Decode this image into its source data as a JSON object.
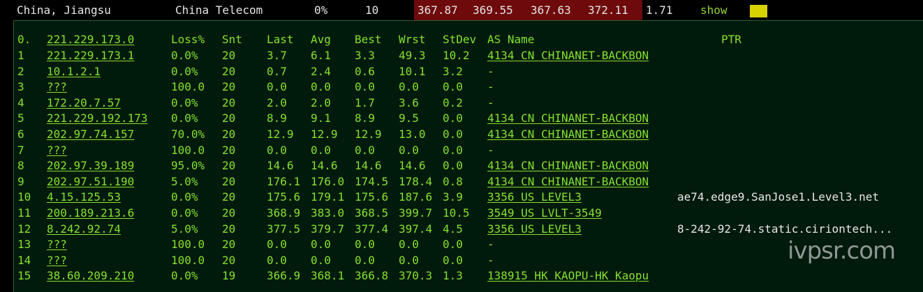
{
  "summary": {
    "location": "China, Jiangsu",
    "isp": "China Telecom",
    "loss": "0%",
    "sent": "10",
    "values": [
      "367.87",
      "369.55",
      "367.63",
      "372.11"
    ],
    "stdev": "1.71",
    "show_label": "show"
  },
  "table": {
    "headers": {
      "hop": "0.",
      "host": "221.229.173.0",
      "loss": "Loss%",
      "snt": "Snt",
      "last": "Last",
      "avg": "Avg",
      "best": "Best",
      "wrst": "Wrst",
      "stdev": "StDev",
      "as": "AS Name",
      "ptr": "PTR"
    },
    "rows": [
      {
        "hop": "1",
        "host": "221.229.173.1",
        "loss": "0.0%",
        "snt": "20",
        "last": "3.7",
        "avg": "6.1",
        "best": "3.3",
        "wrst": "49.3",
        "stdev": "10.2",
        "as": "4134  CN CHINANET-BACKBON",
        "ptr": ""
      },
      {
        "hop": "2",
        "host": "10.1.2.1",
        "loss": "0.0%",
        "snt": "20",
        "last": "0.7",
        "avg": "2.4",
        "best": "0.6",
        "wrst": "10.1",
        "stdev": "3.2",
        "as": "-",
        "ptr": ""
      },
      {
        "hop": "3",
        "host": "???",
        "loss": "100.0",
        "snt": "20",
        "last": "0.0",
        "avg": "0.0",
        "best": "0.0",
        "wrst": "0.0",
        "stdev": "0.0",
        "as": "-",
        "ptr": ""
      },
      {
        "hop": "4",
        "host": "172.20.7.57",
        "loss": "0.0%",
        "snt": "20",
        "last": "2.0",
        "avg": "2.0",
        "best": "1.7",
        "wrst": "3.6",
        "stdev": "0.2",
        "as": "-",
        "ptr": ""
      },
      {
        "hop": "5",
        "host": "221.229.192.173",
        "loss": "0.0%",
        "snt": "20",
        "last": "8.9",
        "avg": "9.1",
        "best": "8.9",
        "wrst": "9.5",
        "stdev": "0.0",
        "as": "4134  CN CHINANET-BACKBON",
        "ptr": ""
      },
      {
        "hop": "6",
        "host": "202.97.74.157",
        "loss": "70.0%",
        "snt": "20",
        "last": "12.9",
        "avg": "12.9",
        "best": "12.9",
        "wrst": "13.0",
        "stdev": "0.0",
        "as": "4134  CN CHINANET-BACKBON",
        "ptr": ""
      },
      {
        "hop": "7",
        "host": "???",
        "loss": "100.0",
        "snt": "20",
        "last": "0.0",
        "avg": "0.0",
        "best": "0.0",
        "wrst": "0.0",
        "stdev": "0.0",
        "as": "-",
        "ptr": ""
      },
      {
        "hop": "8",
        "host": "202.97.39.189",
        "loss": "95.0%",
        "snt": "20",
        "last": "14.6",
        "avg": "14.6",
        "best": "14.6",
        "wrst": "14.6",
        "stdev": "0.0",
        "as": "4134  CN CHINANET-BACKBON",
        "ptr": ""
      },
      {
        "hop": "9",
        "host": "202.97.51.190",
        "loss": "5.0%",
        "snt": "20",
        "last": "176.1",
        "avg": "176.0",
        "best": "174.5",
        "wrst": "178.4",
        "stdev": "0.8",
        "as": "4134  CN CHINANET-BACKBON",
        "ptr": ""
      },
      {
        "hop": "10",
        "host": "4.15.125.53",
        "loss": "0.0%",
        "snt": "20",
        "last": "175.6",
        "avg": "179.1",
        "best": "175.6",
        "wrst": "187.6",
        "stdev": "3.9",
        "as": "3356  US LEVEL3",
        "ptr": "ae74.edge9.SanJose1.Level3.net"
      },
      {
        "hop": "11",
        "host": "200.189.213.6",
        "loss": "0.0%",
        "snt": "20",
        "last": "368.9",
        "avg": "383.0",
        "best": "368.5",
        "wrst": "399.7",
        "stdev": "10.5",
        "as": "3549  US LVLT-3549",
        "ptr": ""
      },
      {
        "hop": "12",
        "host": "8.242.92.74",
        "loss": "5.0%",
        "snt": "20",
        "last": "377.5",
        "avg": "379.7",
        "best": "377.4",
        "wrst": "397.4",
        "stdev": "4.5",
        "as": "3356  US LEVEL3",
        "ptr": "8-242-92-74.static.ciriontech..."
      },
      {
        "hop": "13",
        "host": "???",
        "loss": "100.0",
        "snt": "20",
        "last": "0.0",
        "avg": "0.0",
        "best": "0.0",
        "wrst": "0.0",
        "stdev": "0.0",
        "as": "-",
        "ptr": ""
      },
      {
        "hop": "14",
        "host": "???",
        "loss": "100.0",
        "snt": "20",
        "last": "0.0",
        "avg": "0.0",
        "best": "0.0",
        "wrst": "0.0",
        "stdev": "0.0",
        "as": "-",
        "ptr": ""
      },
      {
        "hop": "15",
        "host": "38.60.209.210",
        "loss": "0.0%",
        "snt": "19",
        "last": "366.9",
        "avg": "368.1",
        "best": "366.8",
        "wrst": "370.3",
        "stdev": "1.3",
        "as": "138915 HK KAOPU-HK Kaopu",
        "ptr": ""
      }
    ]
  },
  "watermark": "ivpsr.com",
  "colors": {
    "text_green": "#86e22f",
    "panel_bg": "#001a0c",
    "summary_red": "#6e0a0c",
    "indicator_yellow": "#d6d300"
  }
}
